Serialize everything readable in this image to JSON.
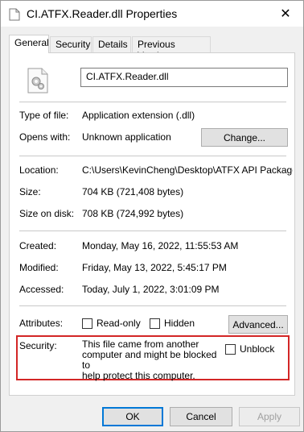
{
  "window": {
    "title": "CI.ATFX.Reader.dll Properties",
    "close_glyph": "✕"
  },
  "tabs": [
    {
      "label": "General",
      "active": true
    },
    {
      "label": "Security"
    },
    {
      "label": "Details"
    },
    {
      "label": "Previous Versions"
    }
  ],
  "file": {
    "name": "CI.ATFX.Reader.dll",
    "icon": "dll-gear-icon"
  },
  "type_section": {
    "type_label": "Type of file:",
    "type_value": "Application extension (.dll)",
    "opens_label": "Opens with:",
    "opens_value": "Unknown application",
    "change_button": "Change..."
  },
  "location_section": {
    "location_label": "Location:",
    "location_value": "C:\\Users\\KevinCheng\\Desktop\\ATFX API Package",
    "size_label": "Size:",
    "size_value": "704 KB (721,408 bytes)",
    "size_on_disk_label": "Size on disk:",
    "size_on_disk_value": "708 KB (724,992 bytes)"
  },
  "dates_section": {
    "created_label": "Created:",
    "created_value": "Monday, May 16, 2022, 11:55:53 AM",
    "modified_label": "Modified:",
    "modified_value": "Friday, May 13, 2022, 5:45:17 PM",
    "accessed_label": "Accessed:",
    "accessed_value": "Today, July 1, 2022, 3:01:09 PM"
  },
  "attributes": {
    "label": "Attributes:",
    "readonly_label": "Read-only",
    "readonly_checked": false,
    "hidden_label": "Hidden",
    "hidden_checked": false,
    "advanced_button": "Advanced..."
  },
  "security": {
    "label": "Security:",
    "text_line1": "This file came from another",
    "text_line2": "computer and might be blocked to",
    "text_line3": "help protect this computer.",
    "unblock_label": "Unblock",
    "unblock_checked": false,
    "highlight_color": "#d32626"
  },
  "footer": {
    "ok": "OK",
    "cancel": "Cancel",
    "apply": "Apply"
  }
}
